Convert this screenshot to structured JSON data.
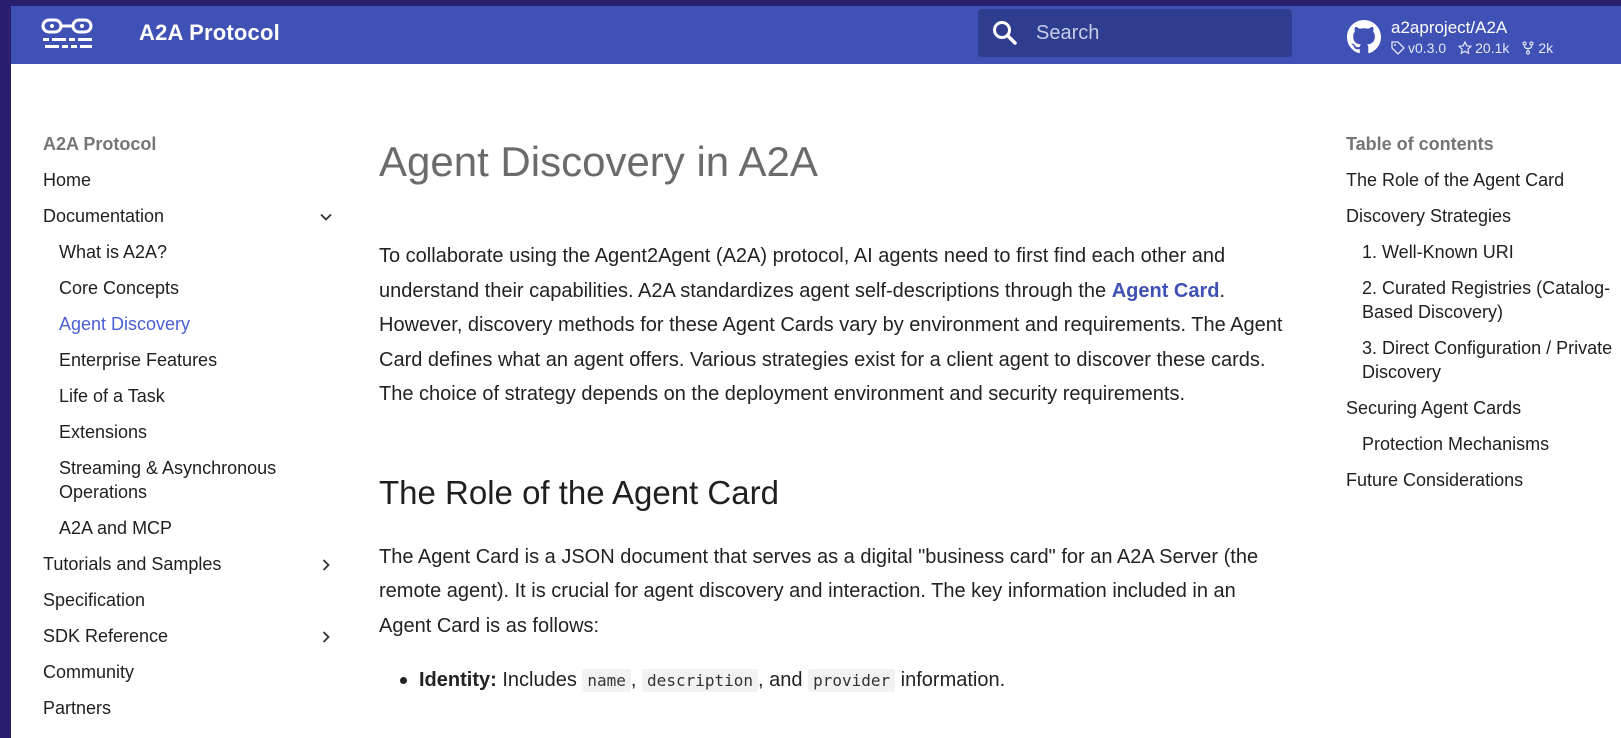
{
  "header": {
    "site_title": "A2A Protocol",
    "search_placeholder": "Search",
    "repo_name": "a2aproject/A2A",
    "repo_version": "v0.3.0",
    "repo_stars": "20.1k",
    "repo_forks": "2k",
    "colors": {
      "bar": "#4051b5",
      "search_bg": "#2f3d8f"
    }
  },
  "nav": {
    "title": "A2A Protocol",
    "items": [
      {
        "label": "Home"
      },
      {
        "label": "Documentation"
      },
      {
        "label": "What is A2A?"
      },
      {
        "label": "Core Concepts"
      },
      {
        "label": "Agent Discovery"
      },
      {
        "label": "Enterprise Features"
      },
      {
        "label": "Life of a Task"
      },
      {
        "label": "Extensions"
      },
      {
        "label": "Streaming & Asynchronous Operations"
      },
      {
        "label": "A2A and MCP"
      },
      {
        "label": "Tutorials and Samples"
      },
      {
        "label": "Specification"
      },
      {
        "label": "SDK Reference"
      },
      {
        "label": "Community"
      },
      {
        "label": "Partners"
      }
    ],
    "active_color": "#4a5fd6"
  },
  "main": {
    "title": "Agent Discovery in A2A",
    "intro_part1": "To collaborate using the Agent2Agent (A2A) protocol, AI agents need to first find each other and understand their capabilities. A2A standardizes agent self-descriptions through the ",
    "intro_link": "Agent Card",
    "intro_part2": ". However, discovery methods for these Agent Cards vary by environment and requirements. The Agent Card defines what an agent offers. Various strategies exist for a client agent to discover these cards. The choice of strategy depends on the deployment environment and security requirements.",
    "section_title": "The Role of the Agent Card",
    "section_para": "The Agent Card is a JSON document that serves as a digital \"business card\" for an A2A Server (the remote agent). It is crucial for agent discovery and interaction. The key information included in an Agent Card is as follows:",
    "bullet_label": "Identity:",
    "bullet_text1": " Includes ",
    "bullet_code1": "name",
    "bullet_sep1": ", ",
    "bullet_code2": "description",
    "bullet_sep2": ", and ",
    "bullet_code3": "provider",
    "bullet_text2": " information."
  },
  "toc": {
    "title": "Table of contents",
    "items": [
      {
        "label": "The Role of the Agent Card"
      },
      {
        "label": "Discovery Strategies"
      },
      {
        "label": "1. Well-Known URI"
      },
      {
        "label": "2. Curated Registries (Catalog-Based Discovery)"
      },
      {
        "label": "3. Direct Configuration / Private Discovery"
      },
      {
        "label": "Securing Agent Cards"
      },
      {
        "label": "Protection Mechanisms"
      },
      {
        "label": "Future Considerations"
      }
    ]
  }
}
